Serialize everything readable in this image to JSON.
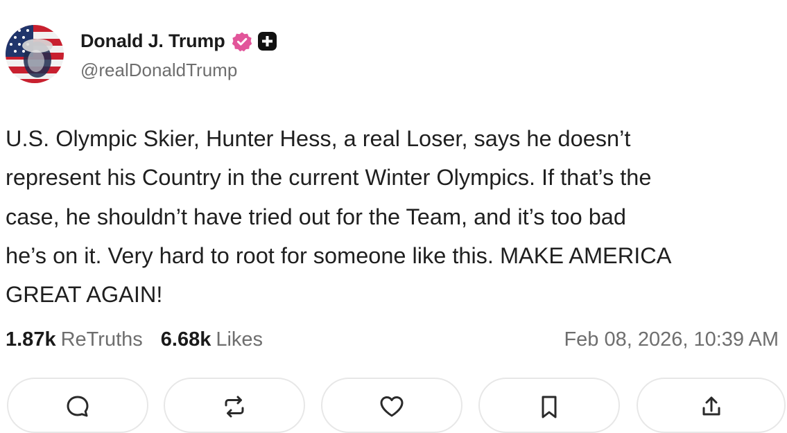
{
  "user": {
    "display_name": "Donald J. Trump",
    "handle": "@realDonaldTrump",
    "verified_icon": "verified-badge-icon",
    "plus_icon": "plus-badge-icon",
    "verified_color": "#e2559a"
  },
  "post": {
    "text": "U.S. Olympic Skier, Hunter Hess, a real Loser, says he doesn’t\nrepresent his Country in the current Winter Olympics. If that’s the\ncase, he shouldn’t have tried out for the Team, and it’s too bad\nhe’s on it. Very hard to root for someone like this. MAKE AMERICA\nGREAT AGAIN!",
    "retruths_count": "1.87k",
    "retruths_label": "ReTruths",
    "likes_count": "6.68k",
    "likes_label": "Likes",
    "timestamp": "Feb 08, 2026, 10:39 AM"
  },
  "actions": [
    {
      "name": "reply",
      "icon": "comment-icon"
    },
    {
      "name": "retruth",
      "icon": "repost-icon"
    },
    {
      "name": "like",
      "icon": "heart-icon"
    },
    {
      "name": "bookmark",
      "icon": "bookmark-icon"
    },
    {
      "name": "share",
      "icon": "share-icon"
    }
  ]
}
